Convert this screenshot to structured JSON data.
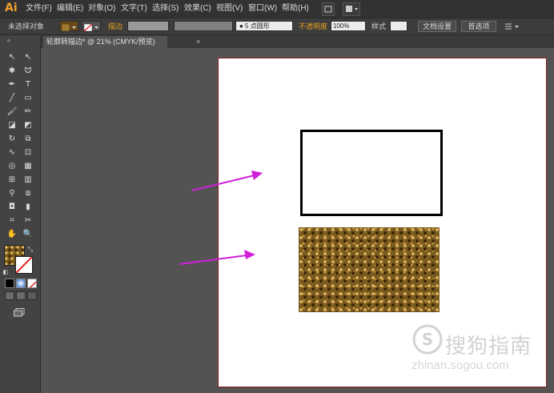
{
  "app": {
    "logo": "Ai"
  },
  "menu": [
    "文件(F)",
    "编辑(E)",
    "对象(O)",
    "文字(T)",
    "选择(S)",
    "效果(C)",
    "视图(V)",
    "窗口(W)",
    "帮助(H)"
  ],
  "control_bar": {
    "selection_status": "未选择对象",
    "stroke_label": "描边",
    "brush_label": "● 5 点圆形",
    "opacity_label": "不透明度",
    "opacity_value": "100%",
    "style_label": "样式",
    "doc_setup_button": "文档设置",
    "preferences_button": "首选项"
  },
  "document_tab": {
    "title": "轮廓转描边* @ 21% (CMYK/预览)",
    "close": "×"
  },
  "watermark": {
    "text": "搜狗指南",
    "url": "zhinan.sogou.com"
  },
  "colors": {
    "arrow": "#d020d8",
    "artboard_border": "#8a1c1c",
    "accent_label": "#e8a020"
  }
}
